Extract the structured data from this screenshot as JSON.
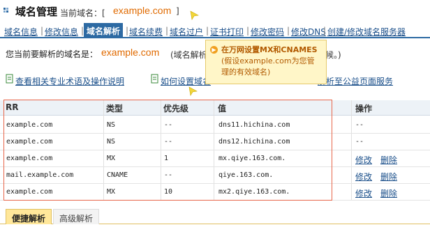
{
  "header": {
    "title": "域名管理",
    "current_label": "当前域名：[",
    "current_domain": "example.com",
    "bracket_close": "]"
  },
  "nav": {
    "items": [
      {
        "label": "域名信息"
      },
      {
        "label": "修改信息"
      },
      {
        "label": "域名解析",
        "active": true
      },
      {
        "label": "域名续费"
      },
      {
        "label": "域名过户"
      },
      {
        "label": "证书打印"
      },
      {
        "label": "修改密码"
      },
      {
        "label": "修改DNS"
      },
      {
        "label": "创建/修改域名服务器"
      }
    ],
    "separator": "|"
  },
  "info": {
    "label": "您当前要解析的域名是：",
    "domain": "example.com",
    "tail_left": "(域名解析",
    "tail_right": "候。)"
  },
  "links": {
    "help": "查看相关专业术语及操作说明",
    "how_to": "如何设置域名",
    "public_page": "解析至公益页面服务"
  },
  "tooltip": {
    "title": "在万网设置MX和CNAMES",
    "body": "(假设example.com为您管理的有效域名)"
  },
  "table": {
    "headers": {
      "rr": "RR",
      "type": "类型",
      "priority": "优先级",
      "value": "值",
      "action": "操作"
    },
    "rows": [
      {
        "rr": "example.com",
        "type": "NS",
        "priority": "--",
        "value": "dns11.hichina.com",
        "action": "--"
      },
      {
        "rr": "example.com",
        "type": "NS",
        "priority": "--",
        "value": "dns12.hichina.com",
        "action": "--"
      },
      {
        "rr": "example.com",
        "type": "MX",
        "priority": "1",
        "value": "mx.qiye.163.com.",
        "edit": "修改",
        "delete": "删除"
      },
      {
        "rr": "mail.example.com",
        "type": "CNAME",
        "priority": "--",
        "value": "qiye.163.com.",
        "edit": "修改",
        "delete": "删除"
      },
      {
        "rr": "example.com",
        "type": "MX",
        "priority": "10",
        "value": "mx2.qiye.163.com.",
        "edit": "修改",
        "delete": "删除"
      }
    ]
  },
  "tabs": {
    "quick": "便捷解析",
    "advanced": "高级解析"
  },
  "colors": {
    "accent": "#2d6aa3",
    "domain": "#e06a00",
    "link": "#1a4f8a",
    "highlight_frame": "#e8664a",
    "tooltip_bg": "#fff6c8"
  },
  "icons": {
    "header": "triangle-icon",
    "help_link": "document-icon",
    "tooltip": "play-circle-icon",
    "cursor": "cursor-arrow-icon"
  }
}
